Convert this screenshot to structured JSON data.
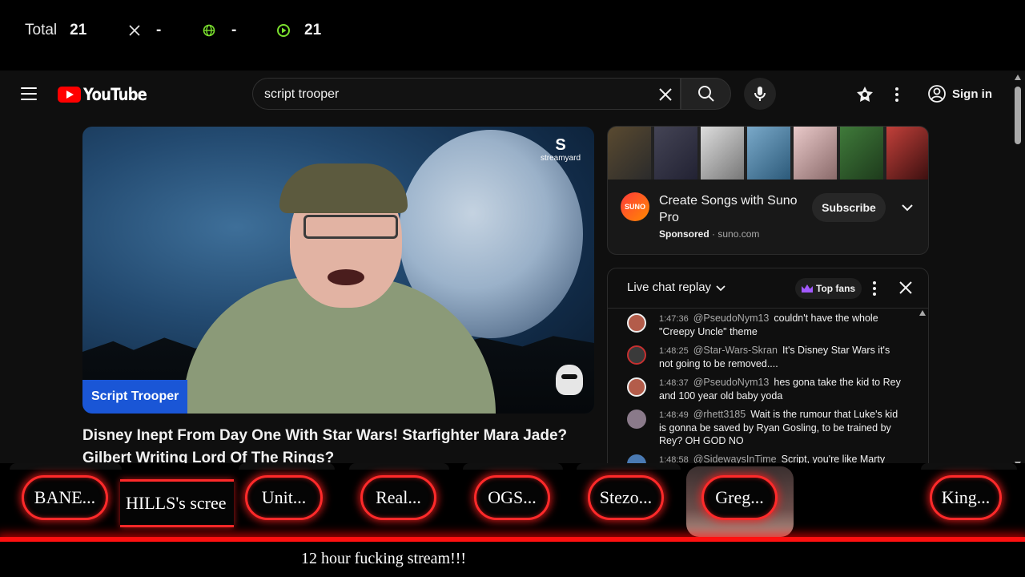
{
  "stats": {
    "total_label": "Total",
    "total_value": "21",
    "x_value": "-",
    "web_value": "-",
    "play_value": "21",
    "icon_names": [
      "x-logo-icon",
      "globe-icon",
      "play-icon"
    ],
    "accent_color": "#7be02e"
  },
  "youtube": {
    "logo_text": "YouTube",
    "search": {
      "value": "script trooper"
    },
    "signin_label": "Sign in",
    "video": {
      "channel_badge": "Script Trooper",
      "watermark": "streamyard",
      "title": "Disney Inept From Day One With Star Wars! Starfighter Mara Jade? Gilbert Writing Lord Of The Rings?"
    },
    "ad": {
      "title": "Create Songs with Suno Pro",
      "logo_text": "SUNO",
      "sponsored_label": "Sponsored",
      "domain": "· suno.com",
      "subscribe_label": "Subscribe"
    },
    "chat": {
      "title": "Live chat replay",
      "top_fans_label": "Top fans",
      "messages": [
        {
          "time": "1:47:36",
          "author": "@PseudoNym13",
          "text": "couldn't have the whole \"Creepy Uncle\" theme"
        },
        {
          "time": "1:48:25",
          "author": "@Star-Wars-Skran",
          "text": "It's Disney Star Wars it's not going to be removed...."
        },
        {
          "time": "1:48:37",
          "author": "@PseudoNym13",
          "text": "hes gona take the kid to Rey and 100 year old baby yoda"
        },
        {
          "time": "1:48:49",
          "author": "@rhett3185",
          "text": "Wait is the rumour that Luke's kid is gonna be saved by Ryan Gosling, to be trained by Rey? OH GOD NO"
        },
        {
          "time": "1:48:58",
          "author": "@SidewaysInTime",
          "text": "Script, you're like Marty"
        }
      ]
    }
  },
  "overlay": {
    "plates": [
      "BANE...",
      "HILLS's scree",
      "Unit...",
      "Real...",
      "OGS...",
      "Stezo...",
      "Greg...",
      "King..."
    ],
    "ticker": "12 hour fucking stream!!!",
    "glow_color": "#ff1a1a"
  }
}
